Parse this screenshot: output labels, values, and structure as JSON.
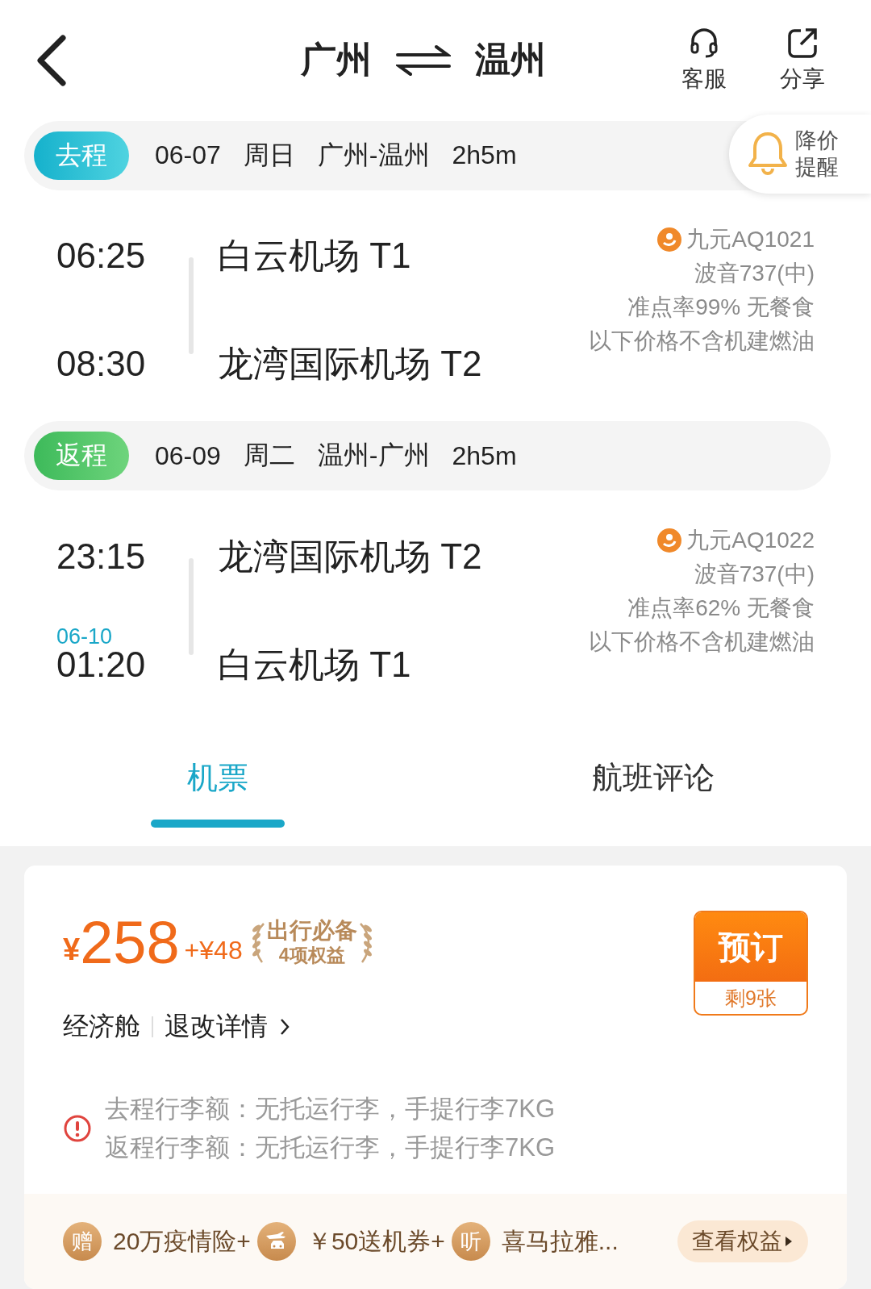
{
  "header": {
    "from": "广州",
    "to": "温州",
    "actions": [
      {
        "label": "客服",
        "kind": "headset"
      },
      {
        "label": "分享",
        "kind": "share"
      }
    ]
  },
  "price_alert": {
    "label": "降价提醒"
  },
  "legs": [
    {
      "badge": "去程",
      "kind": "outbound",
      "date": "06-07",
      "weekday": "周日",
      "route": "广州-温州",
      "duration": "2h5m",
      "depart_time": "06:25",
      "depart_airport": "白云机场 T1",
      "arrive_time": "08:30",
      "arrive_airport": "龙湾国际机场 T2",
      "info": [
        "九元AQ1021",
        "波音737(中)",
        "准点率99% 无餐食",
        "以下价格不含机建燃油"
      ]
    },
    {
      "badge": "返程",
      "kind": "return",
      "date": "06-09",
      "weekday": "周二",
      "route": "温州-广州",
      "duration": "2h5m",
      "depart_time": "23:15",
      "depart_airport": "龙湾国际机场 T2",
      "arrive_date": "06-10",
      "arrive_time": "01:20",
      "arrive_airport": "白云机场 T1",
      "info": [
        "九元AQ1022",
        "波音737(中)",
        "准点率62% 无餐食",
        "以下价格不含机建燃油"
      ]
    }
  ],
  "tabs": [
    {
      "label": "机票",
      "selected": true
    },
    {
      "label": "航班评论",
      "selected": false
    }
  ],
  "fare": {
    "currency": "¥",
    "price": "258",
    "addon": "+¥48",
    "perk_title": "出行必备",
    "perk_sub": "4项权益",
    "cabin": "经济舱",
    "rules_link": "退改详情",
    "book": "预订",
    "remaining": "剩9张",
    "baggage": [
      "去程行李额：无托运行李，手提行李7KG",
      "返程行李额：无托运行李，手提行李7KG"
    ],
    "perks": [
      {
        "kind": "glyph",
        "icon": "赠",
        "text": "20万疫情险+"
      },
      {
        "kind": "drawing",
        "text": "￥50送机券+"
      },
      {
        "kind": "glyph",
        "icon": "听",
        "text": "喜马拉雅..."
      }
    ],
    "view_perks": "查看权益"
  }
}
